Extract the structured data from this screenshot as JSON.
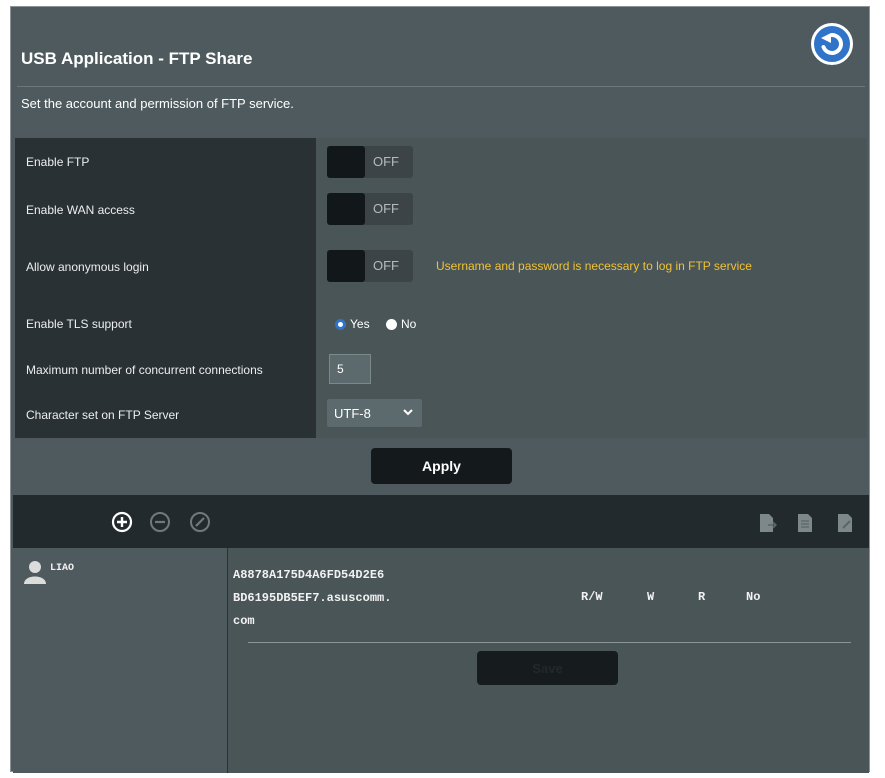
{
  "header": {
    "title": "USB Application - FTP Share",
    "description": "Set the account and permission of FTP service.",
    "back_icon": "back-arrow-icon"
  },
  "settings": {
    "enable_ftp": {
      "label": "Enable FTP",
      "state": "OFF"
    },
    "enable_wan": {
      "label": "Enable WAN access",
      "state": "OFF"
    },
    "anonymous": {
      "label": "Allow anonymous login",
      "state": "OFF",
      "note": "Username and password is necessary to log in FTP service"
    },
    "tls": {
      "label": "Enable TLS support",
      "yes": "Yes",
      "no": "No",
      "selected": "Yes"
    },
    "max_conn": {
      "label": "Maximum number of concurrent connections",
      "value": "5"
    },
    "charset": {
      "label": "Character set on FTP Server",
      "value": "UTF-8"
    }
  },
  "apply_label": "Apply",
  "account_toolbar": {
    "left_icons": [
      "add-circle-icon",
      "remove-circle-icon",
      "edit-circle-icon"
    ],
    "right_icons": [
      "file-export-icon",
      "file-list-icon",
      "file-edit-icon"
    ]
  },
  "account": {
    "username": "LIAO",
    "folder_line1": "A8878A175D4A6FD54D2E6",
    "folder_line2": "BD6195DB5EF7.asuscomm.",
    "folder_line3": "com",
    "permissions": [
      "R/W",
      "W",
      "R",
      "No"
    ],
    "save_label": "Save"
  },
  "colors": {
    "accent": "#2f74c8",
    "warning": "#f1c232",
    "panel": "#4e5a5d",
    "label_bg": "#2a3134"
  }
}
